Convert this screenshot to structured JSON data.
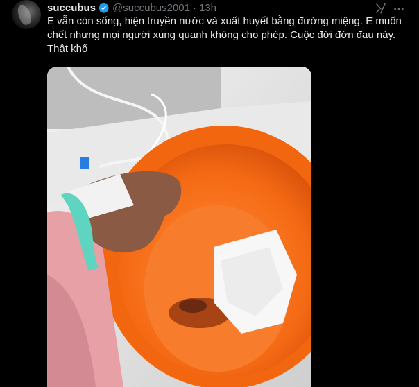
{
  "tweet": {
    "display_name": "succubus",
    "handle": "@succubus2001",
    "separator": "·",
    "time": "13h",
    "text": "E vẫn còn sống, hiện truyền nước và xuất huyết bằng đường miệng. E muốn chết nhưng mọi người xung quanh không cho phép. Cuộc đời đớn đau này. Thật khổ",
    "verified": true,
    "icons": {
      "verified": "verified-badge-icon",
      "grok": "grok-icon",
      "more": "more-options-icon"
    }
  },
  "colors": {
    "background": "#000000",
    "text_primary": "#e7e9ea",
    "text_secondary": "#71767b",
    "verified": "#1d9bf0",
    "basin_orange": "#f56a14"
  }
}
